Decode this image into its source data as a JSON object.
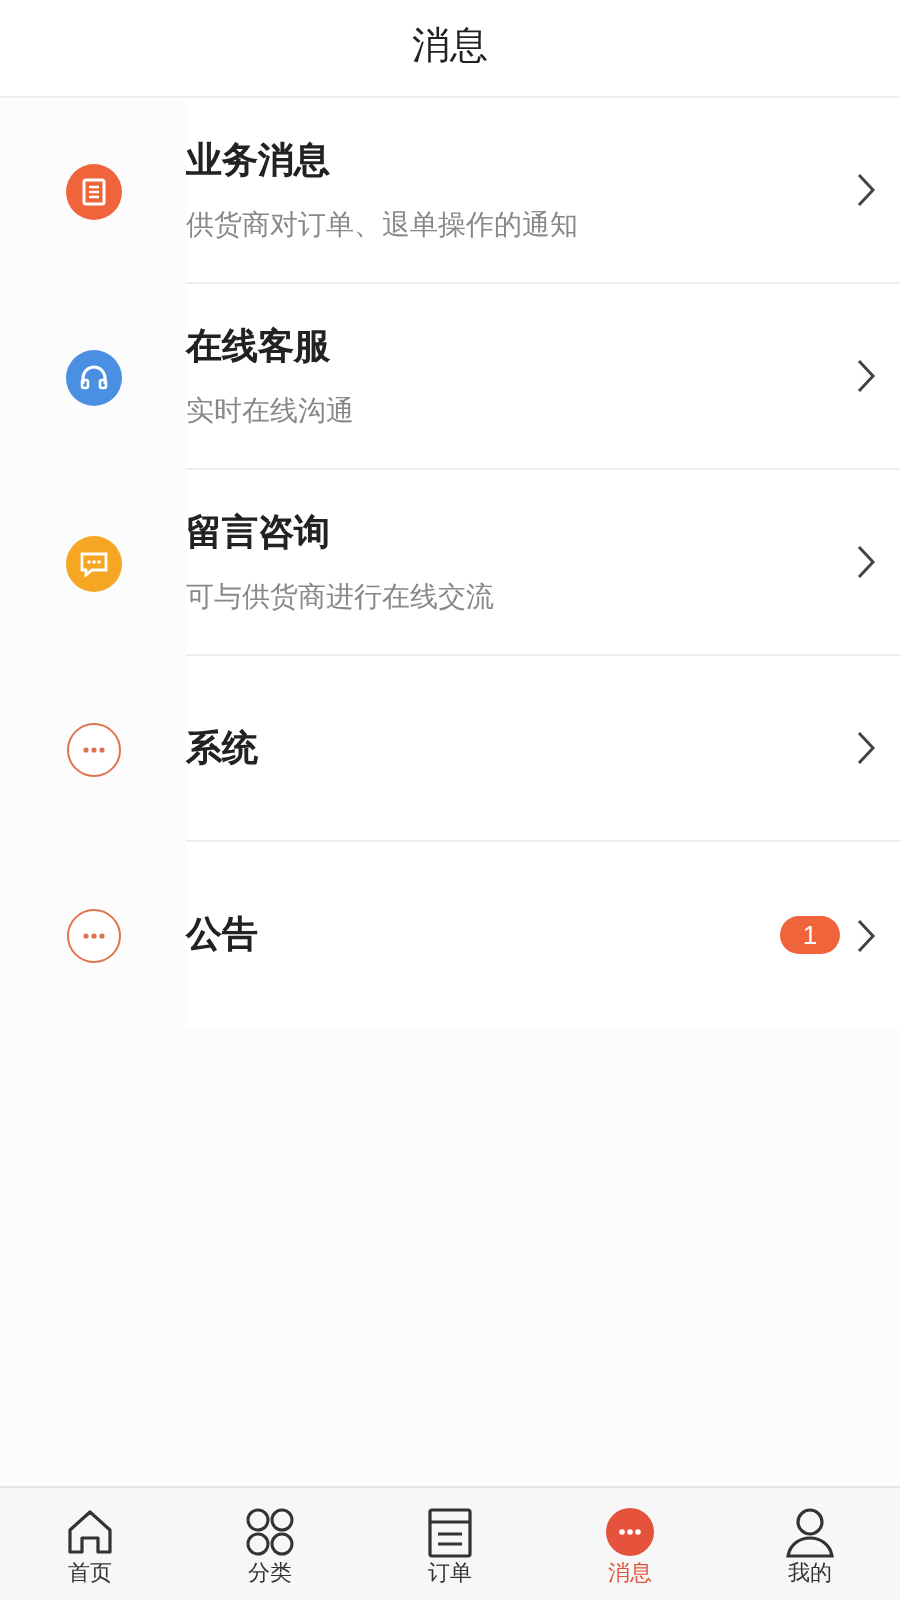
{
  "header": {
    "title": "消息"
  },
  "items": [
    {
      "kind": "list",
      "color": "#f0643c",
      "title": "业务消息",
      "subtitle": "供货商对订单、退单操作的通知"
    },
    {
      "kind": "headset",
      "color": "#4a90e2",
      "title": "在线客服",
      "subtitle": "实时在线沟通"
    },
    {
      "kind": "chat",
      "color": "#f5a623",
      "title": "留言咨询",
      "subtitle": "可与供货商进行在线交流"
    },
    {
      "kind": "more",
      "color": "#e0734f",
      "title": "系统"
    },
    {
      "kind": "more",
      "color": "#e0734f",
      "title": "公告",
      "badge": "1"
    }
  ],
  "tab_bar": [
    {
      "kind": "home",
      "label": "首页",
      "selected": false
    },
    {
      "kind": "grid",
      "label": "分类",
      "selected": false
    },
    {
      "kind": "order",
      "label": "订单",
      "selected": false
    },
    {
      "kind": "message",
      "label": "消息",
      "selected": true
    },
    {
      "kind": "person",
      "label": "我的",
      "selected": false
    }
  ]
}
